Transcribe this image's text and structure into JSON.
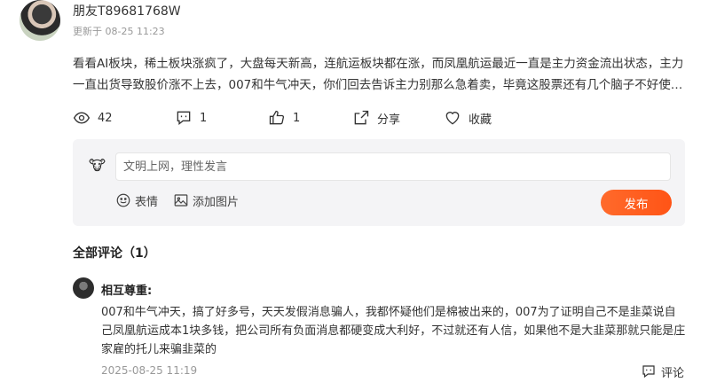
{
  "post": {
    "username": "朋友T89681768W",
    "updated": "更新于 08-25 11:23",
    "text": "看看AI板块，稀土板块涨疯了，大盘每天新高，连航运板块都在涨，而凤凰航运最近一直是主力资金流出状态，主力一直出货导致股价涨不上去，007和牛气冲天，你们回去告诉主力别那么急着卖，毕竟这股票还有几个脑子不好使的看…"
  },
  "actions": {
    "views": "42",
    "comments": "1",
    "likes": "1",
    "share_label": "分享",
    "favorite_label": "收藏"
  },
  "composer": {
    "placeholder": "文明上网，理性发言",
    "emoji_label": "表情",
    "image_label": "添加图片",
    "publish_label": "发布"
  },
  "comments_section": {
    "title": "全部评论（1）",
    "items": [
      {
        "author": "相互尊重:",
        "text": "007和牛气冲天，搞了好多号，天天发假消息骗人，我都怀疑他们是棉被出来的，007为了证明自己不是韭菜说自己凤凰航运成本1块多钱，把公司所有负面消息都硬变成大利好，不过就还有人信，如果他不是大韭菜那就只能是庄家雇的托儿来骗韭菜的",
        "time": "2025-08-25 11:19",
        "reply_label": "评论"
      }
    ]
  },
  "colors": {
    "accent": "#ff5a1f",
    "muted": "#999999",
    "panel": "#f4f4f6"
  }
}
